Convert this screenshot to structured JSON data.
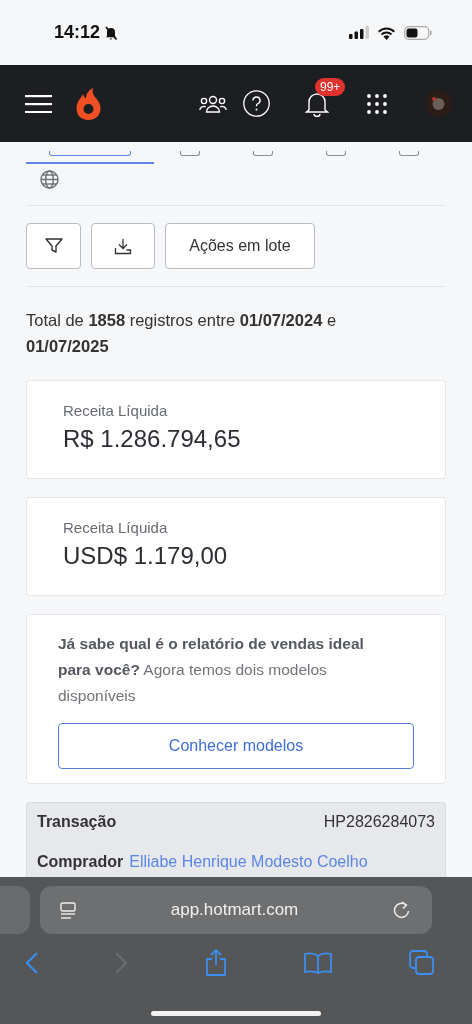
{
  "status_bar": {
    "time": "14:12",
    "silent": true
  },
  "header": {
    "notifications_badge": "99+"
  },
  "tabs": [
    {
      "selected": true
    },
    {
      "selected": false
    },
    {
      "selected": false
    },
    {
      "selected": false
    },
    {
      "selected": false
    }
  ],
  "toolbar": {
    "batch_button": "Ações em lote"
  },
  "summary": "Total de **1858** registros entre **01/07/2024** e **01/07/2025**",
  "revenue_cards": [
    {
      "label": "Receita Líquida",
      "value": "R$ 1.286.794,65"
    },
    {
      "label": "Receita Líquida",
      "value": "USD$ 1.179,00"
    }
  ],
  "promo": {
    "text": "**Já sabe qual é o relatório de vendas ideal para você?** Agora temos dois modelos disponíveis",
    "button": "Conhecer modelos"
  },
  "transaction": {
    "label": "Transação",
    "id": "HP2826284073",
    "buyer_label": "Comprador",
    "buyer_name": "Elliabe Henrique Modesto Coelho"
  },
  "browser": {
    "url": "app.hotmart.com"
  }
}
